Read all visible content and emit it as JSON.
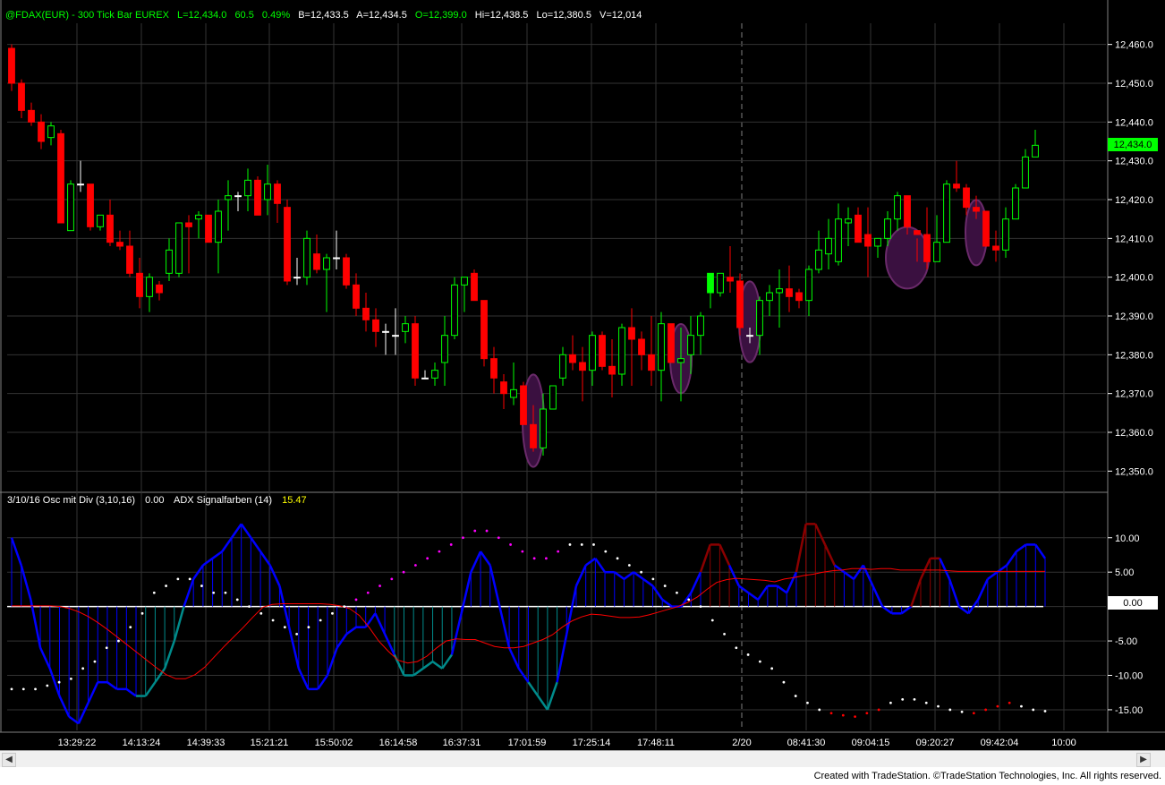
{
  "header": {
    "symbol": "@FDAX(EUR) - 300 Tick Bar  EUREX",
    "last": "L=12,434.0",
    "change": "60.5",
    "change_pct": "0.49%",
    "bid": "B=12,433.5",
    "ask": "A=12,434.5",
    "open": "O=12,399.0",
    "high": "Hi=12,438.5",
    "low": "Lo=12,380.5",
    "volume": "V=12,014"
  },
  "indicator_header": {
    "osc_name": "3/10/16 Osc mit Div (3,10,16)",
    "osc_value": "0.00",
    "adx_name": "ADX Signalfarben (14)",
    "adx_value": "15.47"
  },
  "last_price_tag": "12,434.0",
  "zero_tag": "0.00",
  "time_labels": [
    "13:29:22",
    "14:13:24",
    "14:39:33",
    "15:21:21",
    "15:50:02",
    "16:14:58",
    "16:37:31",
    "17:01:59",
    "17:25:14",
    "17:48:11",
    "2/20",
    "08:41:30",
    "09:04:15",
    "09:20:27",
    "09:42:04",
    "10:00"
  ],
  "footer": "Created with TradeStation. ©TradeStation Technologies, Inc. All rights reserved.",
  "colors": {
    "up": "#00ff00",
    "down": "#ff0000",
    "osc": "#0000ff",
    "osc_teal": "#008b8b",
    "osc_dark_red": "#8b0000",
    "signal": "#ff0000",
    "ellipse": "#6a2a6a",
    "grid": "#333333",
    "background": "#000000"
  },
  "chart_data": [
    {
      "type": "candlestick",
      "ylim": [
        12345,
        12465
      ],
      "yticks": [
        "12,460.0",
        "12,450.0",
        "12,440.0",
        "12,430.0",
        "12,420.0",
        "12,410.0",
        "12,400.0",
        "12,390.0",
        "12,380.0",
        "12,370.0",
        "12,360.0",
        "12,350.0"
      ],
      "ytick_values": [
        12460,
        12450,
        12440,
        12430,
        12420,
        12410,
        12400,
        12390,
        12380,
        12370,
        12360,
        12350
      ],
      "ohlc": [
        [
          12459,
          12460,
          12448,
          12450
        ],
        [
          12450,
          12451,
          12441,
          12443
        ],
        [
          12443,
          12445,
          12439,
          12440
        ],
        [
          12440,
          12442,
          12433,
          12435
        ],
        [
          12436,
          12440,
          12434,
          12439
        ],
        [
          12437,
          12438,
          12414,
          12414
        ],
        [
          12412,
          12425,
          12412,
          12424
        ],
        [
          12424,
          12430,
          12422,
          12424
        ],
        [
          12424,
          12424,
          12412,
          12413
        ],
        [
          12413,
          12416,
          12412,
          12416
        ],
        [
          12416,
          12420,
          12408,
          12409
        ],
        [
          12409,
          12412,
          12407,
          12408
        ],
        [
          12408,
          12412,
          12400,
          12401
        ],
        [
          12401,
          12405,
          12392,
          12395
        ],
        [
          12395,
          12401,
          12391,
          12400
        ],
        [
          12398,
          12399,
          12394,
          12396
        ],
        [
          12401,
          12410,
          12399,
          12407
        ],
        [
          12401,
          12412,
          12400,
          12414
        ],
        [
          12414,
          12416,
          12401,
          12413
        ],
        [
          12415,
          12417,
          12410,
          12416
        ],
        [
          12416,
          12410,
          12409,
          12409
        ],
        [
          12409,
          12420,
          12401,
          12417
        ],
        [
          12420,
          12425,
          12412,
          12421
        ],
        [
          12421,
          12422,
          12417,
          12421
        ],
        [
          12421,
          12428,
          12417,
          12425
        ],
        [
          12425,
          12426,
          12416,
          12416
        ],
        [
          12420,
          12429,
          12416,
          12424
        ],
        [
          12424,
          12425,
          12414,
          12419
        ],
        [
          12418,
          12420,
          12398,
          12399
        ],
        [
          12400,
          12405,
          12398,
          12400
        ],
        [
          12400,
          12412,
          12398,
          12410
        ],
        [
          12406,
          12411,
          12401,
          12402
        ],
        [
          12402,
          12406,
          12391,
          12405
        ],
        [
          12405,
          12412,
          12402,
          12405
        ],
        [
          12405,
          12406,
          12397,
          12398
        ],
        [
          12398,
          12401,
          12390,
          12392
        ],
        [
          12392,
          12396,
          12386,
          12389
        ],
        [
          12389,
          12392,
          12382,
          12386
        ],
        [
          12386,
          12388,
          12380,
          12386
        ],
        [
          12385,
          12392,
          12380,
          12385
        ],
        [
          12386,
          12390,
          12383,
          12388
        ],
        [
          12388,
          12390,
          12372,
          12374
        ],
        [
          12374,
          12376,
          12374,
          12374
        ],
        [
          12374,
          12378,
          12372,
          12376
        ],
        [
          12378,
          12390,
          12372,
          12385
        ],
        [
          12385,
          12400,
          12384,
          12398
        ],
        [
          12398,
          12400,
          12391,
          12400
        ],
        [
          12401,
          12402,
          12395,
          12394
        ],
        [
          12394,
          12394,
          12377,
          12379
        ],
        [
          12379,
          12382,
          12370,
          12374
        ],
        [
          12373,
          12375,
          12366,
          12370
        ],
        [
          12369,
          12378,
          12367,
          12371
        ],
        [
          12372,
          12373,
          12362,
          12362
        ],
        [
          12362,
          12367,
          12355,
          12356
        ],
        [
          12356,
          12370,
          12354,
          12366
        ],
        [
          12366,
          12372,
          12366,
          12372
        ],
        [
          12374,
          12382,
          12372,
          12380
        ],
        [
          12380,
          12385,
          12376,
          12378
        ],
        [
          12378,
          12382,
          12368,
          12376
        ],
        [
          12376,
          12386,
          12372,
          12385
        ],
        [
          12385,
          12386,
          12376,
          12377
        ],
        [
          12377,
          12384,
          12369,
          12375
        ],
        [
          12375,
          12388,
          12372,
          12387
        ],
        [
          12387,
          12392,
          12372,
          12384
        ],
        [
          12384,
          12386,
          12376,
          12380
        ],
        [
          12380,
          12390,
          12372,
          12376
        ],
        [
          12376,
          12391,
          12368,
          12388
        ],
        [
          12388,
          12388,
          12378,
          12378
        ],
        [
          12378,
          12387,
          12368,
          12379
        ],
        [
          12380,
          12390,
          12375,
          12385
        ],
        [
          12385,
          12391,
          12380,
          12390
        ],
        [
          12396,
          12401,
          12392,
          12401
        ],
        [
          12396,
          12401,
          12395,
          12401
        ],
        [
          12400,
          12408,
          12396,
          12399
        ],
        [
          12399,
          12401,
          12385,
          12387
        ],
        [
          12385,
          12387,
          12383,
          12385
        ],
        [
          12385,
          12395,
          12380,
          12394
        ],
        [
          12394,
          12398,
          12390,
          12396
        ],
        [
          12396,
          12402,
          12387,
          12397
        ],
        [
          12397,
          12403,
          12391,
          12395
        ],
        [
          12396,
          12397,
          12392,
          12394
        ],
        [
          12394,
          12403,
          12390,
          12402
        ],
        [
          12402,
          12412,
          12401,
          12407
        ],
        [
          12406,
          12415,
          12402,
          12410
        ],
        [
          12404,
          12419,
          12403,
          12415
        ],
        [
          12414,
          12418,
          12408,
          12415
        ],
        [
          12416,
          12418,
          12409,
          12409
        ],
        [
          12411,
          12418,
          12400,
          12408
        ],
        [
          12408,
          12410,
          12405,
          12410
        ],
        [
          12410,
          12417,
          12408,
          12415
        ],
        [
          12415,
          12422,
          12412,
          12421
        ],
        [
          12421,
          12421,
          12411,
          12413
        ],
        [
          12412,
          12410,
          12404,
          12411
        ],
        [
          12411,
          12418,
          12402,
          12404
        ],
        [
          12404,
          12416,
          12405,
          12409
        ],
        [
          12409,
          12425,
          12410,
          12424
        ],
        [
          12424,
          12430,
          12422,
          12423
        ],
        [
          12423,
          12424,
          12416,
          12418
        ],
        [
          12418,
          12421,
          12415,
          12417
        ],
        [
          12417,
          12415,
          12408,
          12408
        ],
        [
          12408,
          12412,
          12404,
          12407
        ],
        [
          12407,
          12418,
          12405,
          12415
        ],
        [
          12415,
          12424,
          12415,
          12423
        ],
        [
          12423,
          12433,
          12424,
          12431
        ],
        [
          12431,
          12438,
          12431,
          12434
        ]
      ],
      "highlight_ellipses": [
        [
          12362,
          12352,
          12374
        ],
        [
          12380,
          12371,
          12387
        ],
        [
          12385,
          12379,
          12398
        ],
        [
          12406,
          12398,
          12412
        ],
        [
          12412,
          12404,
          12419
        ]
      ]
    },
    {
      "type": "line",
      "ylim": [
        -18,
        14
      ],
      "yticks": [
        "10.00",
        "5.00",
        "0.00",
        "-5.00",
        "-10.00",
        "-15.00"
      ],
      "ytick_values": [
        10,
        5,
        0,
        -5,
        -10,
        -15
      ],
      "series": [
        {
          "values": [
            10,
            6,
            1,
            -6,
            -9,
            -13,
            -16,
            -17,
            -14,
            -11,
            -11,
            -12,
            -12,
            -13,
            -13,
            -11,
            -9,
            -5,
            0,
            4,
            6,
            7,
            8,
            10,
            12,
            10,
            8,
            6,
            3,
            -3,
            -9,
            -12,
            -12,
            -10,
            -6,
            -4,
            -3,
            -3,
            -1,
            -4,
            -7,
            -10,
            -10,
            -9,
            -8,
            -9,
            -7,
            -1,
            5,
            8,
            6,
            0,
            -6,
            -9,
            -11,
            -13,
            -15,
            -11,
            -4,
            3,
            6,
            7,
            5,
            5,
            4,
            5,
            4,
            3,
            1,
            0,
            0,
            2,
            5,
            9,
            9,
            6,
            3,
            2,
            1,
            3,
            3,
            2,
            5,
            12,
            12,
            9,
            6,
            5,
            4,
            6,
            3,
            0,
            -1,
            -1,
            0,
            4,
            7,
            7,
            4,
            0,
            -1,
            1,
            4,
            5,
            6,
            8,
            9,
            9,
            7
          ],
          "x_index_offset": 0
        },
        {
          "values": [
            0.1,
            0.1,
            0.1,
            0.1,
            0.1,
            0,
            -0.3,
            -0.8,
            -1.5,
            -2.4,
            -3.4,
            -4.5,
            -5.6,
            -6.7,
            -7.8,
            -8.9,
            -9.9,
            -10.5,
            -10.5,
            -9.9,
            -8.8,
            -7.3,
            -5.8,
            -4.4,
            -3,
            -1.5,
            -0.1,
            0.3,
            0.4,
            0.4,
            0.4,
            0.4,
            0.4,
            0.3,
            0.1,
            -0.3,
            -1.3,
            -3,
            -5,
            -6.5,
            -7.8,
            -8.2,
            -8,
            -7.2,
            -6,
            -5,
            -4.7,
            -4.8,
            -4.8,
            -5.3,
            -5.8,
            -6,
            -6,
            -5.8,
            -5.3,
            -4.8,
            -4.1,
            -3,
            -2.1,
            -1.5,
            -1.1,
            -1.2,
            -1.4,
            -1.6,
            -1.6,
            -1.5,
            -1.2,
            -0.8,
            -0.4,
            0,
            0.6,
            1.4,
            2.5,
            3.5,
            3.9,
            4.1,
            4,
            3.9,
            3.8,
            3.6,
            4,
            4.2,
            4.5,
            4.7,
            5,
            5.2,
            5.3,
            5.5,
            5.5,
            5.4,
            5.5,
            5.5,
            5.3,
            5.3,
            5.3,
            5.3,
            5.3,
            5.2,
            5.1,
            5.1,
            5.1,
            5.1,
            5.1,
            5.1,
            5.1,
            5.1,
            5.1,
            5.1
          ]
        }
      ],
      "adx_dots": [
        -12,
        -12,
        -12,
        -11.5,
        -11,
        -10.5,
        -9,
        -8,
        -6,
        -5,
        -3,
        -1,
        2,
        3,
        4,
        4,
        3,
        2,
        2,
        1,
        0,
        -1,
        -2,
        -3,
        -4,
        -3,
        -2,
        -1,
        0,
        1,
        2,
        3,
        4,
        5,
        6,
        7,
        8,
        9,
        10,
        11,
        11,
        10,
        9,
        8,
        7,
        7,
        8,
        9,
        9,
        9,
        8,
        7,
        6,
        5,
        4,
        3,
        2,
        1,
        0,
        -2,
        -4,
        -6,
        -7,
        -8,
        -9,
        -11,
        -13,
        -14,
        -15,
        -15.5,
        -15.8,
        -16,
        -15.5,
        -15,
        -14,
        -13.5,
        -13.5,
        -14,
        -14.5,
        -15,
        -15.3,
        -15.5,
        -15,
        -14.5,
        -14,
        -14.5,
        -15,
        -15.2
      ]
    }
  ]
}
